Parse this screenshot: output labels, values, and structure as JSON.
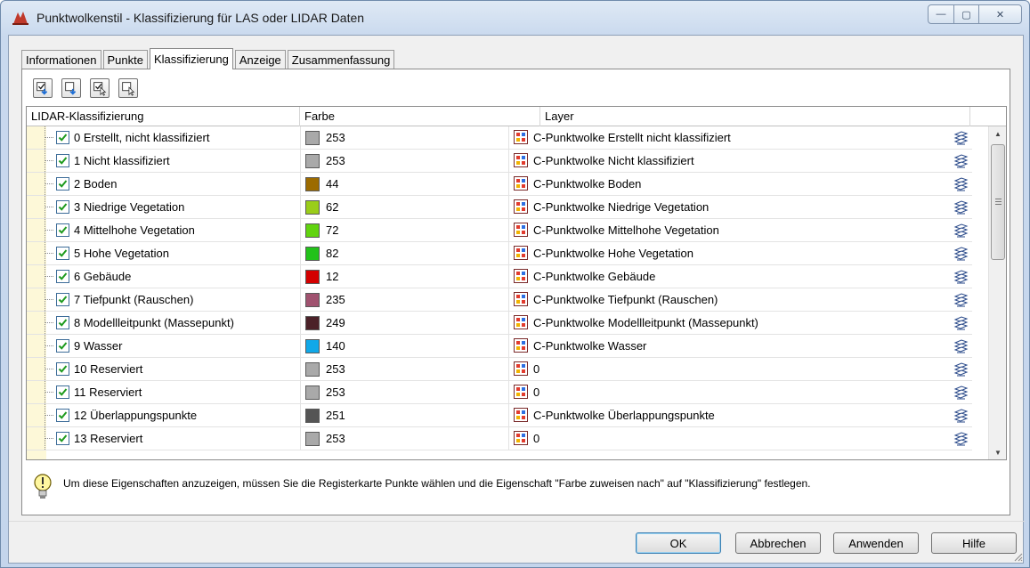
{
  "window": {
    "title": "Punktwolkenstil - Klassifizierung für LAS oder LIDAR Daten",
    "min_glyph": "—",
    "max_glyph": "▢",
    "close_glyph": "✕"
  },
  "tabs": [
    {
      "label": "Informationen",
      "active": false
    },
    {
      "label": "Punkte",
      "active": false
    },
    {
      "label": "Klassifizierung",
      "active": true
    },
    {
      "label": "Anzeige",
      "active": false
    },
    {
      "label": "Zusammenfassung",
      "active": false
    }
  ],
  "toolbar": {
    "icons": [
      "select-all-icon",
      "select-none-icon",
      "invert-selection-icon",
      "clear-selection-icon"
    ]
  },
  "grid": {
    "headers": {
      "classification": "LIDAR-Klassifizierung",
      "color": "Farbe",
      "layer": "Layer"
    },
    "rows": [
      {
        "name": "0 Erstellt, nicht klassifiziert",
        "color_index": "253",
        "hex": "#a9a9a9",
        "layer": "C-Punktwolke Erstellt nicht klassifiziert"
      },
      {
        "name": "1 Nicht klassifiziert",
        "color_index": "253",
        "hex": "#a9a9a9",
        "layer": "C-Punktwolke Nicht klassifiziert"
      },
      {
        "name": "2 Boden",
        "color_index": "44",
        "hex": "#9c6b00",
        "layer": "C-Punktwolke Boden"
      },
      {
        "name": "3 Niedrige Vegetation",
        "color_index": "62",
        "hex": "#9acd1a",
        "layer": "C-Punktwolke Niedrige Vegetation"
      },
      {
        "name": "4 Mittelhohe Vegetation",
        "color_index": "72",
        "hex": "#61d40f",
        "layer": "C-Punktwolke Mittelhohe Vegetation"
      },
      {
        "name": "5 Hohe Vegetation",
        "color_index": "82",
        "hex": "#22c21a",
        "layer": "C-Punktwolke Hohe Vegetation"
      },
      {
        "name": "6 Gebäude",
        "color_index": "12",
        "hex": "#d40000",
        "layer": "C-Punktwolke Gebäude"
      },
      {
        "name": "7 Tiefpunkt (Rauschen)",
        "color_index": "235",
        "hex": "#a0526f",
        "layer": "C-Punktwolke Tiefpunkt (Rauschen)"
      },
      {
        "name": "8 Modellleitpunkt (Massepunkt)",
        "color_index": "249",
        "hex": "#4b2128",
        "layer": "C-Punktwolke Modellleitpunkt (Massepunkt)"
      },
      {
        "name": "9 Wasser",
        "color_index": "140",
        "hex": "#10a8e8",
        "layer": "C-Punktwolke Wasser"
      },
      {
        "name": "10 Reserviert",
        "color_index": "253",
        "hex": "#a9a9a9",
        "layer": "0"
      },
      {
        "name": "11 Reserviert",
        "color_index": "253",
        "hex": "#a9a9a9",
        "layer": "0"
      },
      {
        "name": "12 Überlappungspunkte",
        "color_index": "251",
        "hex": "#555555",
        "layer": "C-Punktwolke Überlappungspunkte"
      },
      {
        "name": "13 Reserviert",
        "color_index": "253",
        "hex": "#a9a9a9",
        "layer": "0"
      }
    ]
  },
  "info": {
    "text": "Um diese Eigenschaften anzuzeigen, müssen Sie die Registerkarte Punkte wählen und die Eigenschaft \"Farbe zuweisen nach\" auf \"Klassifizierung\" festlegen."
  },
  "buttons": {
    "ok": "OK",
    "cancel": "Abbrechen",
    "apply": "Anwenden",
    "help": "Hilfe"
  },
  "colors": {
    "tree_margin": "#fdf8d8",
    "check": "#1d9a1d",
    "titlebar": "#c9d9ee"
  }
}
